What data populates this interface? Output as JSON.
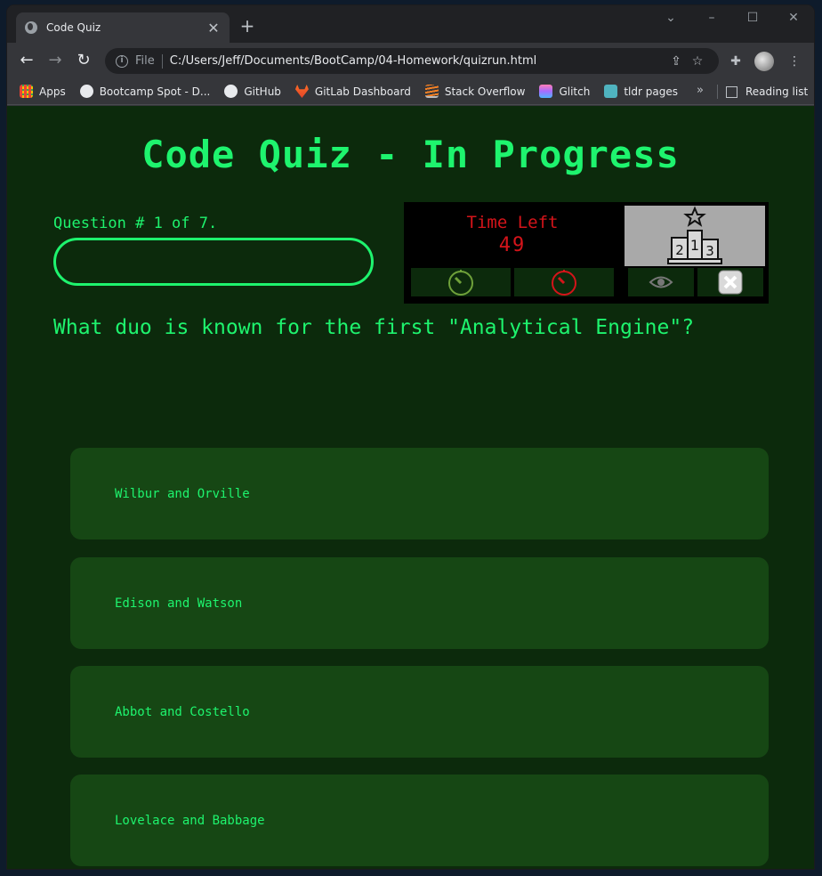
{
  "browser": {
    "tab_title": "Code Quiz",
    "tab_close": "✕",
    "new_tab": "+",
    "url_scheme": "File",
    "url": "C:/Users/Jeff/Documents/BootCamp/04-Homework/quizrun.html",
    "bookmarks": [
      {
        "label": "Apps",
        "icon": "apps-grid-icon",
        "color": "#4285f4"
      },
      {
        "label": "Bootcamp Spot - D...",
        "icon": "bootcamp-icon",
        "color": "#e8eaed"
      },
      {
        "label": "GitHub",
        "icon": "github-icon",
        "color": "#e8eaed"
      },
      {
        "label": "GitLab Dashboard",
        "icon": "gitlab-icon",
        "color": "#e24329"
      },
      {
        "label": "Stack Overflow",
        "icon": "stackoverflow-icon",
        "color": "#f48024"
      },
      {
        "label": "Glitch",
        "icon": "glitch-icon",
        "color": "#a66cff"
      },
      {
        "label": "tldr pages",
        "icon": "tldr-icon",
        "color": "#4fb3bf"
      }
    ],
    "bookmarks_more": "»",
    "reading_list": "Reading list"
  },
  "quiz": {
    "title": "Code Quiz - In Progress",
    "question_count": "Question # 1 of 7.",
    "progress_fraction": 0,
    "timer_label": "Time Left",
    "timer_value": "49",
    "question": "What duo is known for the first \"Analytical Engine\"?",
    "answers": [
      "Wilbur and Orville",
      "Edison and Watson",
      "Abbot and Costello",
      "Lovelace and Babbage"
    ]
  },
  "colors": {
    "accent": "#1ef46e",
    "page_bg": "#0c2a0c",
    "answer_bg": "#164714",
    "timer": "#d4141a"
  }
}
